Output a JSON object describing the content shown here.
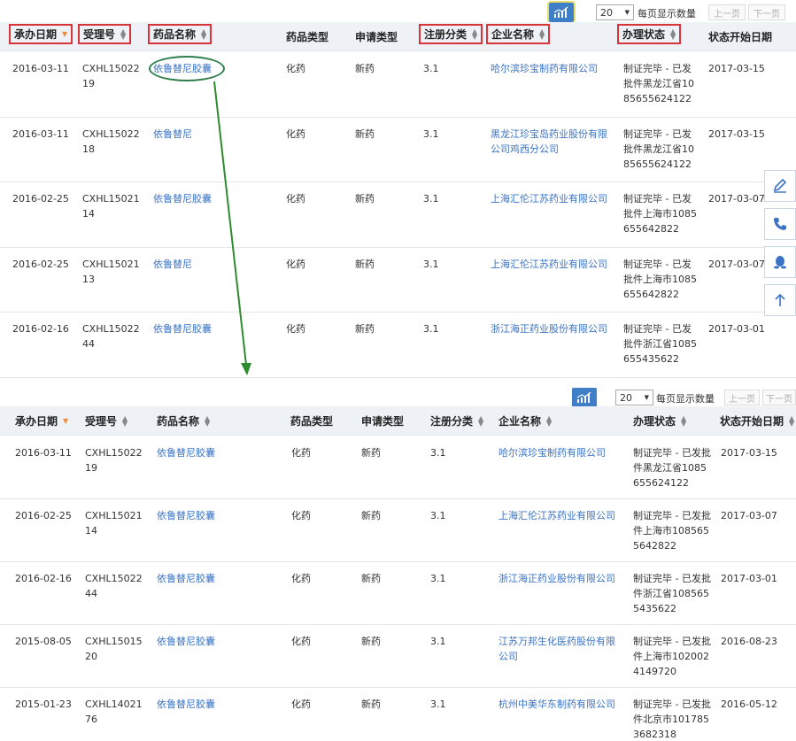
{
  "pager": {
    "size_value": "20",
    "per_page_label": "每页显示数量",
    "prev_label": "上一页",
    "next_label": "下一页"
  },
  "columns": {
    "date": "承办日期",
    "accept_no": "受理号",
    "drug_name": "药品名称",
    "drug_type": "药品类型",
    "apply_type": "申请类型",
    "reg_class": "注册分类",
    "company": "企业名称",
    "status": "办理状态",
    "status_start": "状态开始日期"
  },
  "top_rows": [
    {
      "date": "2016-03-11",
      "accept_no": "CXHL1502219",
      "drug_name": "依鲁替尼胶囊",
      "drug_type": "化药",
      "apply_type": "新药",
      "reg_class": "3.1",
      "company": "哈尔滨珍宝制药有限公司",
      "status": "制证完毕 - 已发批件黑龙江省1085655624122",
      "status_start": "2017-03-15"
    },
    {
      "date": "2016-03-11",
      "accept_no": "CXHL1502218",
      "drug_name": "依鲁替尼",
      "drug_type": "化药",
      "apply_type": "新药",
      "reg_class": "3.1",
      "company": "黑龙江珍宝岛药业股份有限公司鸡西分公司",
      "status": "制证完毕 - 已发批件黑龙江省1085655624122",
      "status_start": "2017-03-15"
    },
    {
      "date": "2016-02-25",
      "accept_no": "CXHL1502114",
      "drug_name": "依鲁替尼胶囊",
      "drug_type": "化药",
      "apply_type": "新药",
      "reg_class": "3.1",
      "company": "上海汇伦江苏药业有限公司",
      "status": "制证完毕 - 已发批件上海市1085655642822",
      "status_start": "2017-03-07"
    },
    {
      "date": "2016-02-25",
      "accept_no": "CXHL1502113",
      "drug_name": "依鲁替尼",
      "drug_type": "化药",
      "apply_type": "新药",
      "reg_class": "3.1",
      "company": "上海汇伦江苏药业有限公司",
      "status": "制证完毕 - 已发批件上海市1085655642822",
      "status_start": "2017-03-07"
    },
    {
      "date": "2016-02-16",
      "accept_no": "CXHL1502244",
      "drug_name": "依鲁替尼胶囊",
      "drug_type": "化药",
      "apply_type": "新药",
      "reg_class": "3.1",
      "company": "浙江海正药业股份有限公司",
      "status": "制证完毕 - 已发批件浙江省1085655435622",
      "status_start": "2017-03-01"
    }
  ],
  "bottom_rows": [
    {
      "date": "2016-03-11",
      "accept_no": "CXHL1502219",
      "drug_name": "依鲁替尼胶囊",
      "drug_type": "化药",
      "apply_type": "新药",
      "reg_class": "3.1",
      "company": "哈尔滨珍宝制药有限公司",
      "status": "制证完毕 - 已发批件黑龙江省1085655624122",
      "status_start": "2017-03-15"
    },
    {
      "date": "2016-02-25",
      "accept_no": "CXHL1502114",
      "drug_name": "依鲁替尼胶囊",
      "drug_type": "化药",
      "apply_type": "新药",
      "reg_class": "3.1",
      "company": "上海汇伦江苏药业有限公司",
      "status": "制证完毕 - 已发批件上海市1085655642822",
      "status_start": "2017-03-07"
    },
    {
      "date": "2016-02-16",
      "accept_no": "CXHL1502244",
      "drug_name": "依鲁替尼胶囊",
      "drug_type": "化药",
      "apply_type": "新药",
      "reg_class": "3.1",
      "company": "浙江海正药业股份有限公司",
      "status": "制证完毕 - 已发批件浙江省1085655435622",
      "status_start": "2017-03-01"
    },
    {
      "date": "2015-08-05",
      "accept_no": "CXHL1501520",
      "drug_name": "依鲁替尼胶囊",
      "drug_type": "化药",
      "apply_type": "新药",
      "reg_class": "3.1",
      "company": "江苏万邦生化医药股份有限公司",
      "status": "制证完毕 - 已发批件上海市1020024149720",
      "status_start": "2016-08-23"
    },
    {
      "date": "2015-01-23",
      "accept_no": "CXHL1402176",
      "drug_name": "依鲁替尼胶囊",
      "drug_type": "化药",
      "apply_type": "新药",
      "reg_class": "3.1",
      "company": "杭州中美华东制药有限公司",
      "status": "制证完毕 - 已发批件北京市1017853682318",
      "status_start": "2016-05-12"
    }
  ],
  "side_tools": [
    {
      "icon": "pencil-icon"
    },
    {
      "icon": "phone-icon"
    },
    {
      "icon": "qq-penguin-icon"
    },
    {
      "icon": "arrow-up-icon"
    }
  ],
  "colors": {
    "link": "#3a73c4",
    "header_bg": "#eef2f6",
    "highlight_box": "#d9343a",
    "annotation_green": "#2e7d4a",
    "chart_button": "#3f7fc8"
  }
}
